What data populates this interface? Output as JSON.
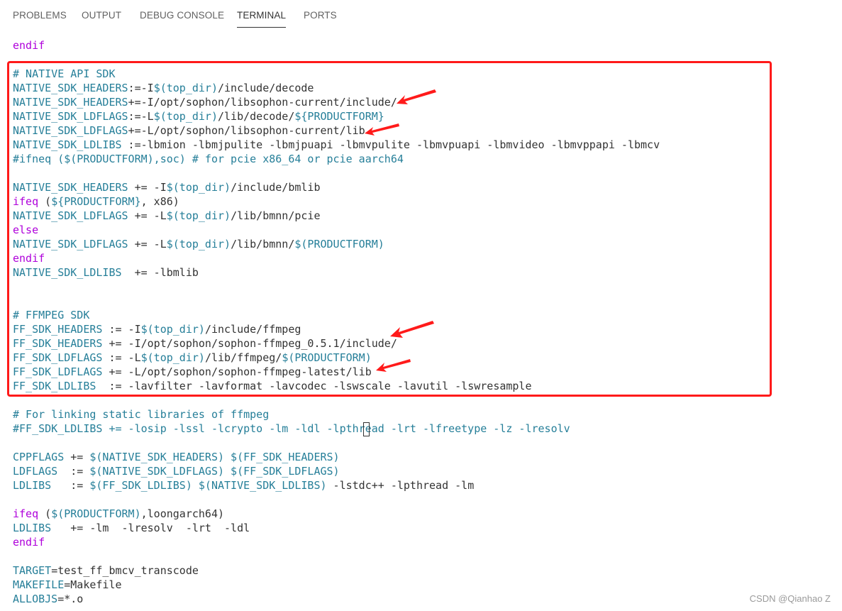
{
  "panel": {
    "tabs": [
      "PROBLEMS",
      "OUTPUT",
      "DEBUG CONSOLE",
      "TERMINAL",
      "PORTS"
    ],
    "active_tab": "TERMINAL"
  },
  "lines": [
    [
      [
        "endif",
        "kw"
      ]
    ],
    [],
    [
      [
        "# NATIVE API SDK",
        "cmt"
      ]
    ],
    [
      [
        "NATIVE_SDK_HEADERS",
        "var"
      ],
      [
        ":=-I",
        "plain"
      ],
      [
        "$(top_dir)",
        "var"
      ],
      [
        "/include/decode",
        "plain"
      ]
    ],
    [
      [
        "NATIVE_SDK_HEADERS",
        "var"
      ],
      [
        "+=-I/opt/sophon/libsophon-current/include/",
        "plain"
      ]
    ],
    [
      [
        "NATIVE_SDK_LDFLAGS",
        "var"
      ],
      [
        ":=-L",
        "plain"
      ],
      [
        "$(top_dir)",
        "var"
      ],
      [
        "/lib/decode/",
        "plain"
      ],
      [
        "${PRODUCTFORM}",
        "var"
      ]
    ],
    [
      [
        "NATIVE_SDK_LDFLAGS",
        "var"
      ],
      [
        "+=-L/opt/sophon/libsophon-current/lib",
        "plain"
      ]
    ],
    [
      [
        "NATIVE_SDK_LDLIBS",
        "var"
      ],
      [
        " :=-lbmion -lbmjpulite -lbmjpuapi -lbmvpulite -lbmvpuapi -lbmvideo -lbmvppapi -lbmcv",
        "plain"
      ]
    ],
    [
      [
        "#ifneq ($(PRODUCTFORM),soc) # for pcie x86_64 or pcie aarch64",
        "cmt"
      ]
    ],
    [],
    [
      [
        "NATIVE_SDK_HEADERS",
        "var"
      ],
      [
        " += -I",
        "plain"
      ],
      [
        "$(top_dir)",
        "var"
      ],
      [
        "/include/bmlib",
        "plain"
      ]
    ],
    [
      [
        "ifeq",
        "kw"
      ],
      [
        " (",
        "plain"
      ],
      [
        "${PRODUCTFORM}",
        "var"
      ],
      [
        ", x86)",
        "plain"
      ]
    ],
    [
      [
        "NATIVE_SDK_LDFLAGS",
        "var"
      ],
      [
        " += -L",
        "plain"
      ],
      [
        "$(top_dir)",
        "var"
      ],
      [
        "/lib/bmnn/pcie",
        "plain"
      ]
    ],
    [
      [
        "else",
        "kw"
      ]
    ],
    [
      [
        "NATIVE_SDK_LDFLAGS",
        "var"
      ],
      [
        " += -L",
        "plain"
      ],
      [
        "$(top_dir)",
        "var"
      ],
      [
        "/lib/bmnn/",
        "plain"
      ],
      [
        "$(PRODUCTFORM)",
        "var"
      ]
    ],
    [
      [
        "endif",
        "kw"
      ]
    ],
    [
      [
        "NATIVE_SDK_LDLIBS",
        "var"
      ],
      [
        "  += -lbmlib",
        "plain"
      ]
    ],
    [],
    [],
    [
      [
        "# FFMPEG SDK",
        "cmt"
      ]
    ],
    [
      [
        "FF_SDK_HEADERS",
        "var"
      ],
      [
        " := -I",
        "plain"
      ],
      [
        "$(top_dir)",
        "var"
      ],
      [
        "/include/ffmpeg",
        "plain"
      ]
    ],
    [
      [
        "FF_SDK_HEADERS",
        "var"
      ],
      [
        " += -I/opt/sophon/sophon-ffmpeg_0.5.1/include/",
        "plain"
      ]
    ],
    [
      [
        "FF_SDK_LDFLAGS",
        "var"
      ],
      [
        " := -L",
        "plain"
      ],
      [
        "$(top_dir)",
        "var"
      ],
      [
        "/lib/ffmpeg/",
        "plain"
      ],
      [
        "$(PRODUCTFORM)",
        "var"
      ]
    ],
    [
      [
        "FF_SDK_LDFLAGS",
        "var"
      ],
      [
        " += -L/opt/sophon/sophon-ffmpeg-latest/lib",
        "plain"
      ]
    ],
    [
      [
        "FF_SDK_LDLIBS",
        "var"
      ],
      [
        "  := -lavfilter -lavformat -lavcodec -lswscale -lavutil -lswresample",
        "plain"
      ]
    ],
    [],
    [
      [
        "# For linking static libraries of ffmpeg",
        "cmt"
      ]
    ],
    [
      [
        "#FF_SDK_LDLIBS += -losip -lssl -lcrypto -lm -ldl -lpthread -lrt -lfreetype -lz -lresolv",
        "cmt"
      ]
    ],
    [],
    [
      [
        "CPPFLAGS",
        "var"
      ],
      [
        " += ",
        "plain"
      ],
      [
        "$(NATIVE_SDK_HEADERS) $(FF_SDK_HEADERS)",
        "var"
      ]
    ],
    [
      [
        "LDFLAGS",
        "var"
      ],
      [
        "  := ",
        "plain"
      ],
      [
        "$(NATIVE_SDK_LDFLAGS) $(FF_SDK_LDFLAGS)",
        "var"
      ]
    ],
    [
      [
        "LDLIBS",
        "var"
      ],
      [
        "   := ",
        "plain"
      ],
      [
        "$(FF_SDK_LDLIBS) $(NATIVE_SDK_LDLIBS)",
        "var"
      ],
      [
        " -lstdc++ -lpthread -lm",
        "plain"
      ]
    ],
    [],
    [
      [
        "ifeq",
        "kw"
      ],
      [
        " (",
        "plain"
      ],
      [
        "$(PRODUCTFORM)",
        "var"
      ],
      [
        ",loongarch64)",
        "plain"
      ]
    ],
    [
      [
        "LDLIBS",
        "var"
      ],
      [
        "   += -lm  -lresolv  -lrt  -ldl",
        "plain"
      ]
    ],
    [
      [
        "endif",
        "kw"
      ]
    ],
    [],
    [
      [
        "TARGET",
        "var"
      ],
      [
        "=test_ff_bmcv_transcode",
        "plain"
      ]
    ],
    [
      [
        "MAKEFILE",
        "var"
      ],
      [
        "=Makefile",
        "plain"
      ]
    ],
    [
      [
        "ALLOBJS",
        "var"
      ],
      [
        "=*.o",
        "plain"
      ]
    ]
  ],
  "watermark": "CSDN @Qianhao Z",
  "colors": {
    "variable": "#267f99",
    "keyword": "#af00db",
    "text": "#333333",
    "highlight_box": "#ff1a1a",
    "arrow": "#ff1a1a"
  }
}
